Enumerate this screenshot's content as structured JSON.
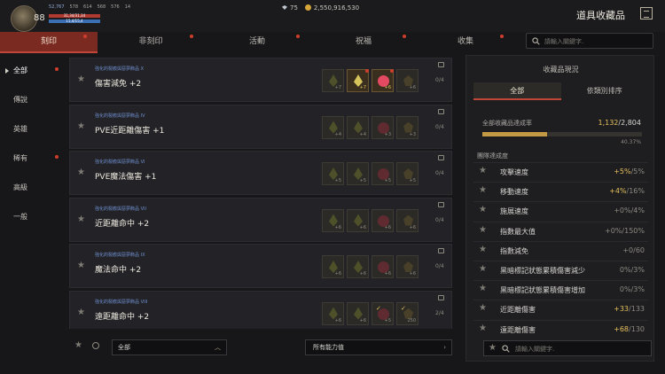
{
  "player": {
    "level": "88",
    "stats": [
      "52,767",
      "578",
      "614",
      "568",
      "576",
      "14"
    ],
    "hp_text": "31,34/31,34",
    "mp_text": "15,4/15,4"
  },
  "currency": {
    "gems": "75",
    "gold": "2,550,916,530"
  },
  "page_title": "道具收藏品",
  "tabs": [
    {
      "label": "刻印",
      "active": true,
      "dot": true
    },
    {
      "label": "非刻印",
      "active": false,
      "dot": true
    },
    {
      "label": "活動",
      "active": false,
      "dot": true
    },
    {
      "label": "祝福",
      "active": false,
      "dot": true
    },
    {
      "label": "收集",
      "active": false,
      "dot": true
    }
  ],
  "search_top": {
    "placeholder": "請輸入關鍵字."
  },
  "sidebar": [
    {
      "label": "全部",
      "active": true,
      "dot": true
    },
    {
      "label": "傳說",
      "active": false,
      "dot": false
    },
    {
      "label": "英雄",
      "active": false,
      "dot": false
    },
    {
      "label": "稀有",
      "active": false,
      "dot": true
    },
    {
      "label": "高級",
      "active": false,
      "dot": false
    },
    {
      "label": "一般",
      "active": false,
      "dot": false
    }
  ],
  "rows": [
    {
      "sub": "強化的裂痕與惡夢飾品 X",
      "name": "傷害減免 +2",
      "progress": "0/4",
      "slots": [
        {
          "g": "a",
          "c": "+7",
          "o": false
        },
        {
          "g": "a",
          "c": "+7",
          "o": true,
          "d": true
        },
        {
          "g": "b",
          "c": "+6",
          "o": true,
          "d": true
        },
        {
          "g": "c",
          "c": "+6",
          "o": false
        }
      ]
    },
    {
      "sub": "強化的裂痕與惡夢飾品 IV",
      "name": "PVE近距離傷害 +1",
      "progress": "0/4",
      "slots": [
        {
          "g": "a",
          "c": "+4",
          "o": false
        },
        {
          "g": "a",
          "c": "+4",
          "o": false
        },
        {
          "g": "b",
          "c": "+3",
          "o": false
        },
        {
          "g": "c",
          "c": "+3",
          "o": false
        }
      ]
    },
    {
      "sub": "強化的裂痕與惡夢飾品 VI",
      "name": "PVE魔法傷害 +1",
      "progress": "0/4",
      "slots": [
        {
          "g": "a",
          "c": "+5",
          "o": false
        },
        {
          "g": "a",
          "c": "+5",
          "o": false
        },
        {
          "g": "b",
          "c": "+5",
          "o": false
        },
        {
          "g": "c",
          "c": "+5",
          "o": false
        }
      ]
    },
    {
      "sub": "強化的裂痕與惡夢飾品 VII",
      "name": "近距離命中 +2",
      "progress": "0/4",
      "slots": [
        {
          "g": "a",
          "c": "+6",
          "o": false
        },
        {
          "g": "a",
          "c": "+6",
          "o": false
        },
        {
          "g": "b",
          "c": "+6",
          "o": false
        },
        {
          "g": "c",
          "c": "+6",
          "o": false
        }
      ]
    },
    {
      "sub": "強化的裂痕與惡夢飾品 IX",
      "name": "魔法命中 +2",
      "progress": "0/4",
      "slots": [
        {
          "g": "a",
          "c": "+6",
          "o": false
        },
        {
          "g": "a",
          "c": "+6",
          "o": false
        },
        {
          "g": "b",
          "c": "+6",
          "o": false
        },
        {
          "g": "c",
          "c": "+6",
          "o": false
        }
      ]
    },
    {
      "sub": "強化的裂痕與惡夢飾品 VIII",
      "name": "遠距離命中 +2",
      "progress": "2/4",
      "slots": [
        {
          "g": "a",
          "c": "+6",
          "o": false
        },
        {
          "g": "a",
          "c": "+6",
          "o": false
        },
        {
          "g": "b",
          "c": "+5",
          "o": false,
          "k": true
        },
        {
          "g": "c",
          "c": "250",
          "o": false,
          "k": true
        }
      ]
    }
  ],
  "bottom": {
    "filter1": "全部",
    "filter2": "所有能力值"
  },
  "panel": {
    "title": "收藏品現況",
    "tabs": [
      "全部",
      "依類別排序"
    ],
    "rate_label": "全部收藏品達成率",
    "rate_current": "1,132",
    "rate_total": "/2,804",
    "rate_fraction": 0.4037,
    "rate_pct": "40.37%",
    "section_label": "團隊達成度",
    "stats": [
      {
        "name": "攻擊速度",
        "bonus": "+5%",
        "total": "/5%",
        "gold": true
      },
      {
        "name": "移動速度",
        "bonus": "+4%",
        "total": "/16%",
        "gold": true
      },
      {
        "name": "施展速度",
        "bonus": "+0%",
        "total": "/4%",
        "gold": false
      },
      {
        "name": "指數最大值",
        "bonus": "+0%",
        "total": "/150%",
        "gold": false
      },
      {
        "name": "指數減免",
        "bonus": "+0",
        "total": "/60",
        "gold": false
      },
      {
        "name": "黑暗標記狀態累積傷害減少",
        "bonus": "0%",
        "total": "/3%",
        "gold": false
      },
      {
        "name": "黑暗標記狀態累積傷害增加",
        "bonus": "0%",
        "total": "/3%",
        "gold": false
      },
      {
        "name": "近距離傷害",
        "bonus": "+33",
        "total": "/133",
        "gold": true
      },
      {
        "name": "遠距離傷害",
        "bonus": "+68",
        "total": "/130",
        "gold": true
      }
    ],
    "search_placeholder": "請輸入關鍵字."
  },
  "icons": {
    "star": "star-icon",
    "search": "search-icon",
    "lock": "lock-icon",
    "menu": "menu-icon"
  }
}
